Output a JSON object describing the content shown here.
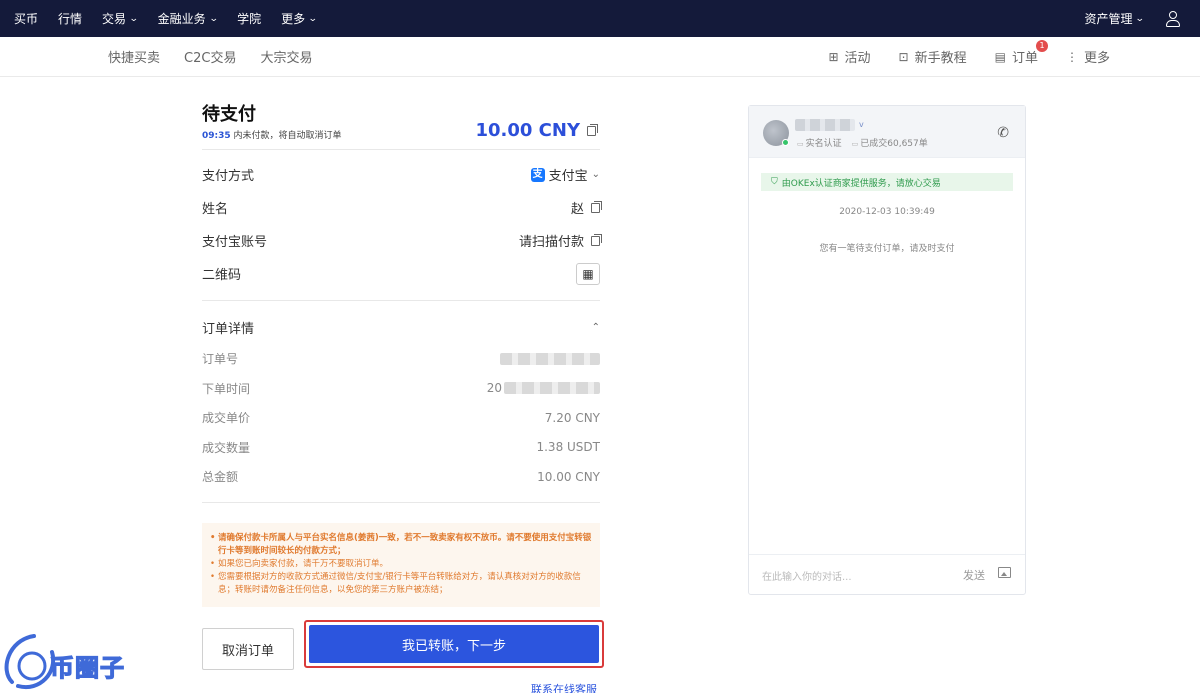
{
  "topbar": {
    "nav": [
      {
        "label": "买币",
        "dropdown": false
      },
      {
        "label": "行情",
        "dropdown": false
      },
      {
        "label": "交易",
        "dropdown": true
      },
      {
        "label": "金融业务",
        "dropdown": true
      },
      {
        "label": "学院",
        "dropdown": false
      },
      {
        "label": "更多",
        "dropdown": true
      }
    ],
    "asset_label": "资产管理",
    "chevron": "⌄"
  },
  "subnav": {
    "left": [
      "快捷买卖",
      "C2C交易",
      "大宗交易"
    ],
    "right": {
      "activity": "活动",
      "tutorial": "新手教程",
      "orders": "订单",
      "orders_badge": "1",
      "more": "更多"
    }
  },
  "order": {
    "title": "待支付",
    "countdown_time": "09:35",
    "countdown_text": "内未付款，将自动取消订单",
    "amount": "10.00 CNY",
    "payment_method_label": "支付方式",
    "payment_method_value": "支付宝",
    "name_label": "姓名",
    "name_value": "赵",
    "account_label": "支付宝账号",
    "account_value": "请扫描付款",
    "qrcode_label": "二维码",
    "details_label": "订单详情",
    "details": {
      "order_no_label": "订单号",
      "time_label": "下单时间",
      "time_prefix": "20",
      "price_label": "成交单价",
      "price_value": "7.20 CNY",
      "qty_label": "成交数量",
      "qty_value": "1.38 USDT",
      "total_label": "总金额",
      "total_value": "10.00 CNY"
    },
    "notices": [
      "请确保付款卡所属人与平台实名信息(姜茜)一致，若不一致卖家有权不放币。请不要使用支付宝转银行卡等到账时间较长的付款方式；",
      "如果您已向卖家付款，请千万不要取消订单。",
      "您需要根据对方的收款方式通过微信/支付宝/银行卡等平台转账给对方，请认真核对对方的收款信息；转账时请勿备注任何信息，以免您的第三方账户被冻结；"
    ],
    "cancel_button": "取消订单",
    "next_button": "我已转账，下一步",
    "service_link": "联系在线客服"
  },
  "chat": {
    "verified_label": "实名认证",
    "trades_label": "已成交60,657单",
    "vbadge": "v",
    "verify_notice": "由OKEx认证商家提供服务，请放心交易",
    "timestamp": "2020-12-03 10:39:49",
    "message": "您有一笔待支付订单，请及时支付",
    "input_placeholder": "在此输入你的对话...",
    "send_label": "发送"
  },
  "watermark": {
    "text": "币圈子"
  },
  "colors": {
    "topbar_bg": "#141a3a",
    "primary": "#2c55de",
    "notice_text": "#e07a2e",
    "verify_green": "#2f9b4d",
    "highlight_red": "#d93b3b"
  }
}
